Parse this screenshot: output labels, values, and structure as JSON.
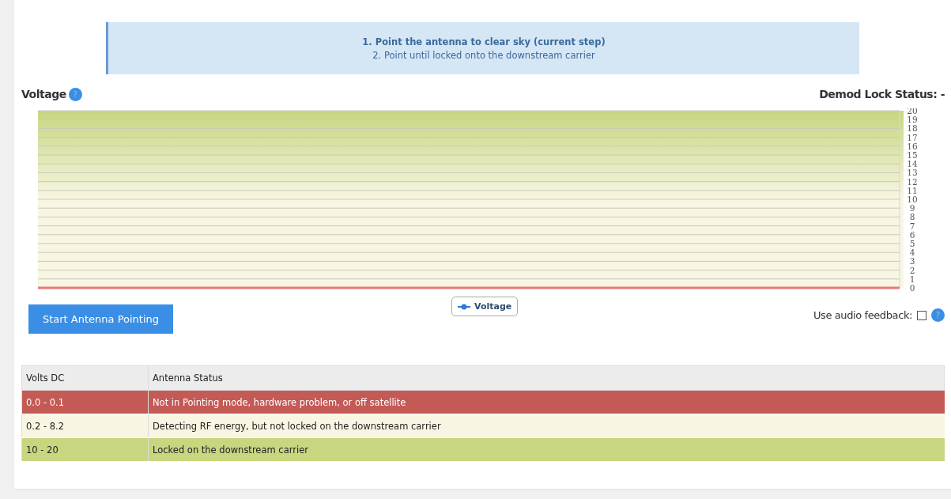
{
  "steps": [
    {
      "text": "1. Point the antenna to clear sky (current step)",
      "current": true
    },
    {
      "text": "2. Point until locked onto the downstream carrier",
      "current": false
    }
  ],
  "voltage_title": "Voltage",
  "help_icon": "?",
  "demod_lock_status": "Demod Lock Status: -",
  "chart_data": {
    "type": "line",
    "grid": true,
    "ylim": [
      0,
      20
    ],
    "yticks": [
      0,
      1,
      2,
      3,
      4,
      5,
      6,
      7,
      8,
      9,
      10,
      11,
      12,
      13,
      14,
      15,
      16,
      17,
      18,
      19,
      20
    ],
    "series": [
      {
        "name": "Voltage",
        "color": "#2b7bd8"
      }
    ]
  },
  "start_button": "Start Antenna Pointing",
  "audio_feedback": {
    "label": "Use audio feedback:",
    "checked": false,
    "help": "?"
  },
  "table": {
    "columns": [
      "Volts DC",
      "Antenna Status"
    ],
    "rows": [
      {
        "cells": [
          "0.0 - 0.1",
          "Not in Pointing mode, hardware problem, or off satellite"
        ],
        "kind": "error",
        "color": "#c45a55"
      },
      {
        "cells": [
          "0.2 - 8.2",
          "Detecting RF energy, but not locked on the downstream carrier"
        ],
        "kind": "warning",
        "color": "#f8f6e2"
      },
      {
        "cells": [
          "10 - 20",
          "Locked on the downstream carrier"
        ],
        "kind": "ok",
        "color": "#c8d680"
      }
    ]
  }
}
